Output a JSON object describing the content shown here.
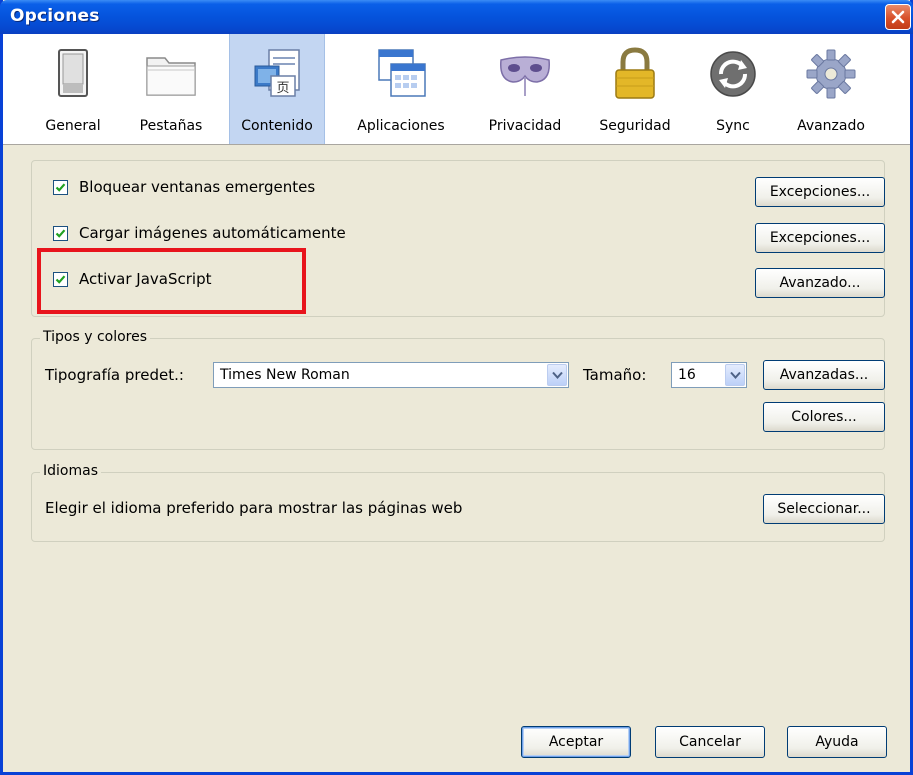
{
  "window": {
    "title": "Opciones"
  },
  "tabs": [
    {
      "label": "General",
      "icon": "general-switch-icon"
    },
    {
      "label": "Pestañas",
      "icon": "folder-tabs-icon"
    },
    {
      "label": "Contenido",
      "icon": "content-document-icon",
      "selected": true
    },
    {
      "label": "Aplicaciones",
      "icon": "applications-calendar-icon"
    },
    {
      "label": "Privacidad",
      "icon": "privacy-mask-icon"
    },
    {
      "label": "Seguridad",
      "icon": "padlock-icon"
    },
    {
      "label": "Sync",
      "icon": "sync-arrows-icon"
    },
    {
      "label": "Avanzado",
      "icon": "gear-icon"
    }
  ],
  "content": {
    "popups": {
      "label": "Bloquear ventanas emergentes",
      "checked": true,
      "button": "Excepciones..."
    },
    "images": {
      "label": "Cargar imágenes automáticamente",
      "checked": true,
      "button": "Excepciones..."
    },
    "javascript": {
      "label": "Activar JavaScript",
      "checked": true,
      "button": "Avanzado..."
    }
  },
  "fonts": {
    "legend": "Tipos y colores",
    "font_label": "Tipografía predet.:",
    "font_value": "Times New Roman",
    "size_label": "Tamaño:",
    "size_value": "16",
    "advanced_button": "Avanzadas...",
    "colors_button": "Colores..."
  },
  "languages": {
    "legend": "Idiomas",
    "description": "Elegir el idioma preferido para mostrar las páginas web",
    "select_button": "Seleccionar..."
  },
  "footer": {
    "ok": "Aceptar",
    "cancel": "Cancelar",
    "help": "Ayuda"
  },
  "colors": {
    "titlebar": "#0553DC",
    "highlight": "#E8141C",
    "dialog": "#ECE9D8",
    "tab_selected": "#C3D6F2"
  }
}
